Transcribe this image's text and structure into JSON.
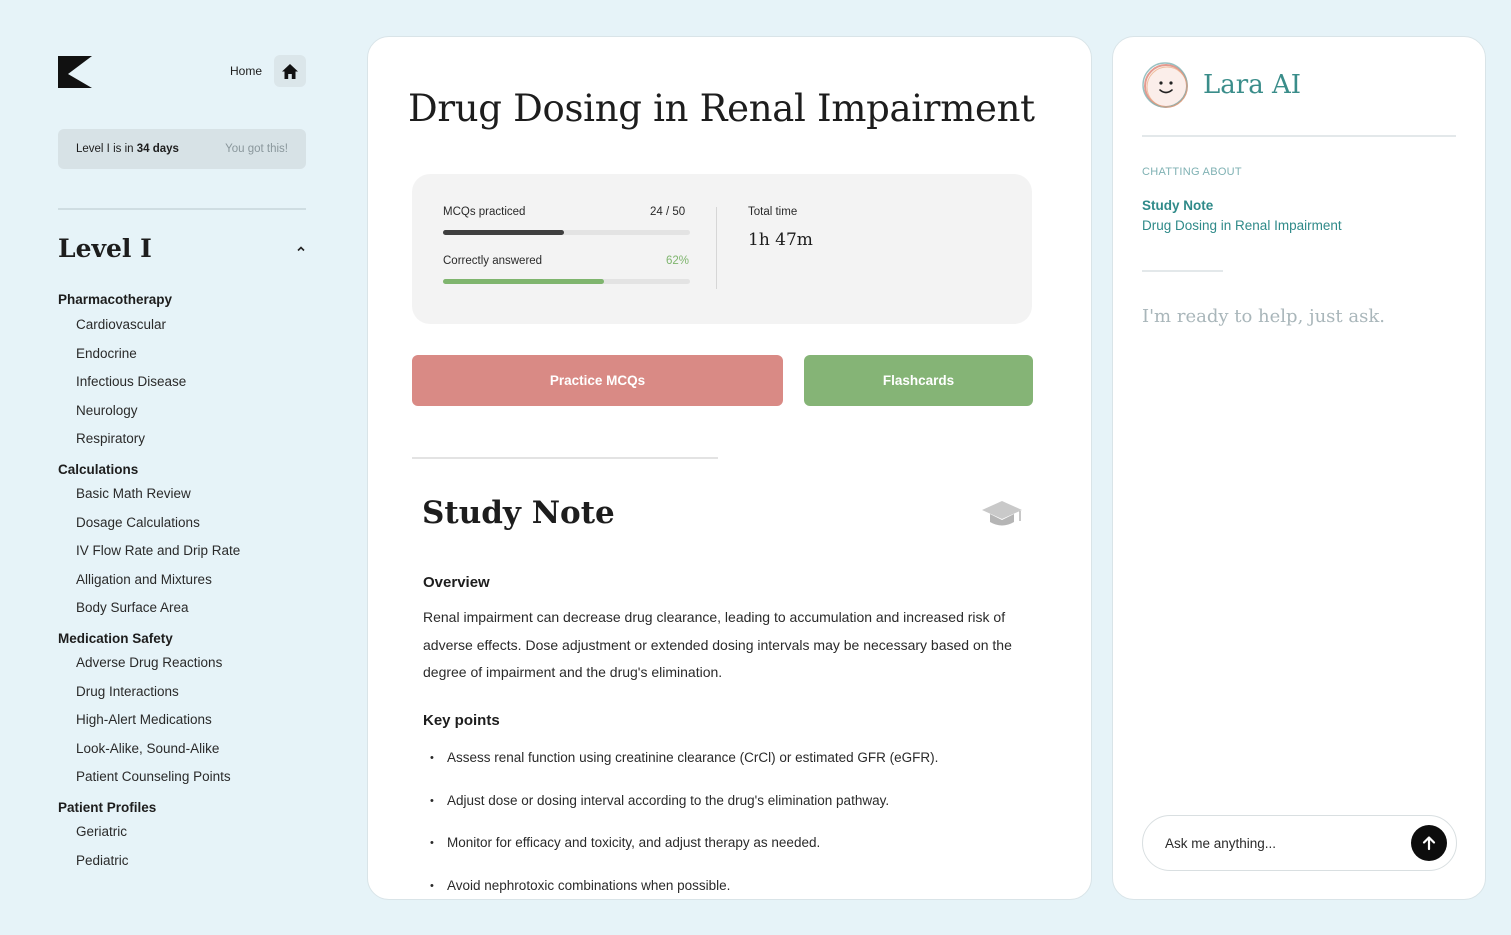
{
  "sidebar": {
    "home_label": "Home",
    "banner_prefix": "Level I is in ",
    "banner_days": "34 days",
    "banner_encouragement": "You got this!",
    "level_title": "Level I",
    "groups": [
      {
        "title": "Pharmacotherapy",
        "items": [
          "Cardiovascular",
          "Endocrine",
          "Infectious Disease",
          "Neurology",
          "Respiratory"
        ]
      },
      {
        "title": "Calculations",
        "items": [
          "Basic Math Review",
          "Dosage Calculations",
          "IV Flow Rate and Drip Rate",
          "Alligation and Mixtures",
          "Body Surface Area"
        ]
      },
      {
        "title": "Medication Safety",
        "items": [
          "Adverse Drug Reactions",
          "Drug Interactions",
          "High-Alert Medications",
          "Look-Alike, Sound-Alike",
          "Patient Counseling Points"
        ]
      },
      {
        "title": "Patient Profiles",
        "items": [
          "Geriatric",
          "Pediatric"
        ]
      }
    ]
  },
  "main": {
    "title": "Drug Dosing in Renal Impairment",
    "stats": {
      "mcq_label": "MCQs practiced",
      "mcq_value": "24 / 50",
      "mcq_progress": 0.49,
      "correct_label": "Correctly answered",
      "correct_value": "62%",
      "correct_progress": 0.65,
      "time_label": "Total time",
      "time_value": "1h 47m"
    },
    "buttons": {
      "practice": "Practice MCQs",
      "flashcards": "Flashcards"
    },
    "study_note": {
      "title": "Study Note",
      "overview_heading": "Overview",
      "overview_text": "Renal impairment can decrease drug clearance, leading to accumulation and increased risk of adverse effects. Dose adjustment or extended dosing intervals may be necessary based on the degree of impairment and the drug's elimination.",
      "key_points_heading": "Key points",
      "key_points": [
        "Assess renal function using creatinine clearance (CrCl) or estimated GFR (eGFR).",
        "Adjust dose or dosing interval according to the drug's elimination pathway.",
        "Monitor for efficacy and toxicity, and adjust therapy as needed.",
        "Avoid nephrotoxic combinations when possible."
      ]
    }
  },
  "chat": {
    "name": "Lara AI",
    "chatting_about_label": "CHATTING ABOUT",
    "context_title": "Study Note",
    "context_subtitle": "Drug Dosing in Renal Impairment",
    "ready_message": "I'm ready to help, just ask.",
    "input_placeholder": "Ask me anything..."
  },
  "colors": {
    "page_bg": "#e6f3f8",
    "mcq_bar": "#3f3f3f",
    "correct_bar": "#7fb56e",
    "practice_button": "#d98a85",
    "flashcards_button": "#85b476",
    "accent_teal": "#2f8a89"
  },
  "icons": {
    "logo": "k-logo",
    "home": "home-icon",
    "chevron": "chevron-up-icon",
    "study_note": "graduation-cap-icon",
    "avatar": "smiley-face-icon",
    "send": "arrow-up-icon"
  }
}
